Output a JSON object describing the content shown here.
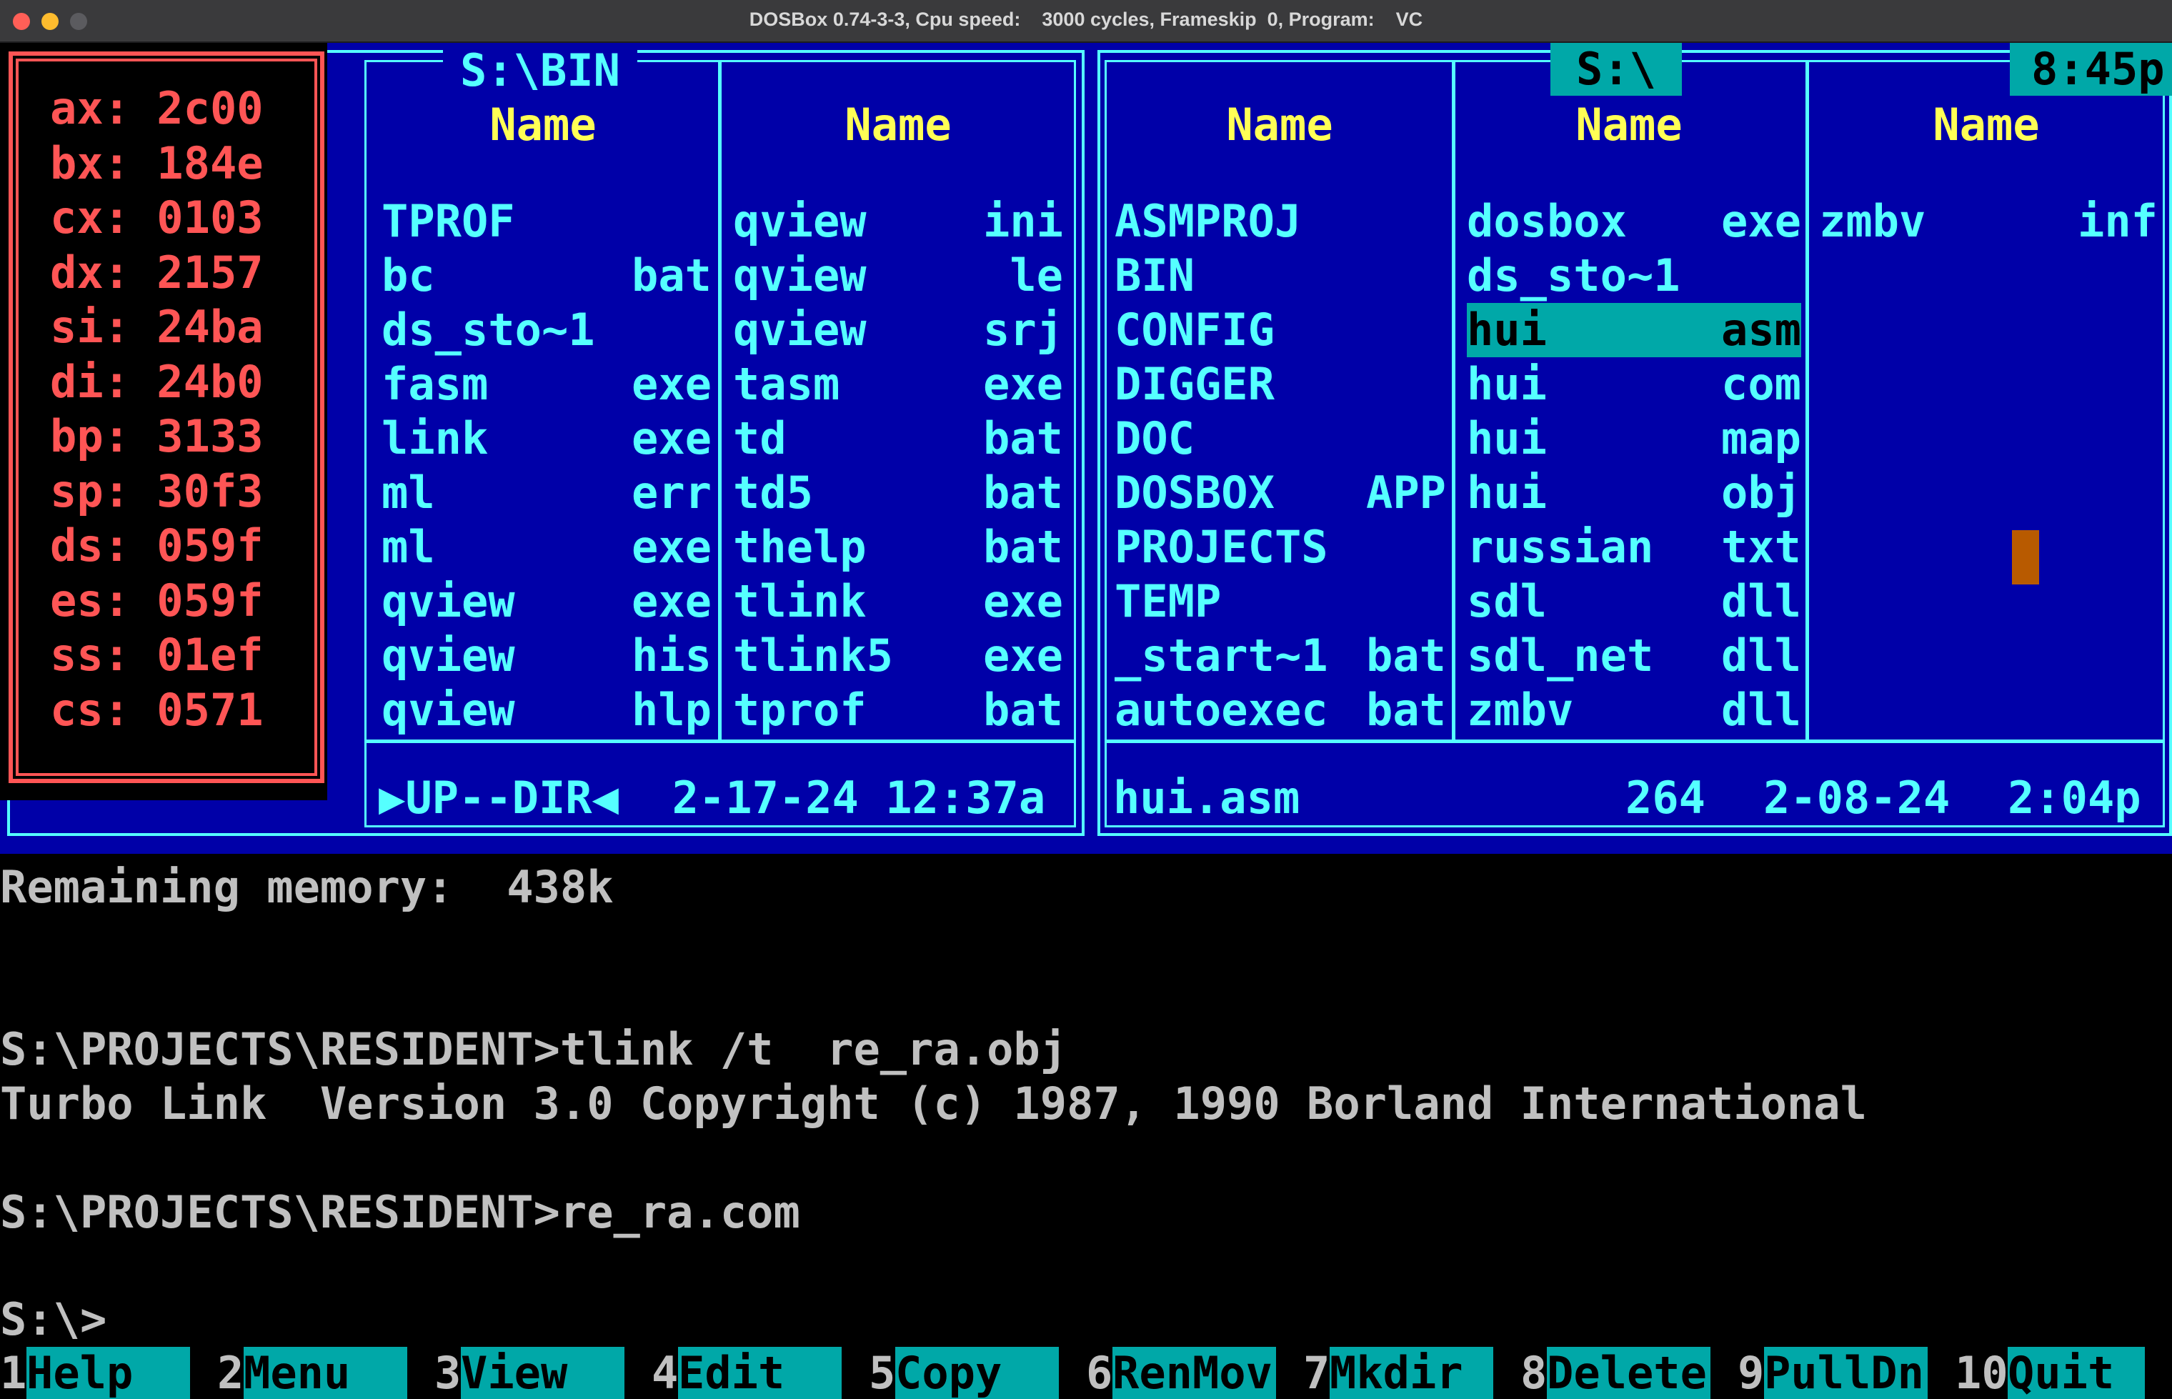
{
  "window": {
    "title": "DOSBox 0.74-3-3, Cpu speed:    3000 cycles, Frameskip  0, Program:    VC"
  },
  "left_panel": {
    "path": "S:\\BIN",
    "col_header": "Name",
    "col1": [
      {
        "name": "TPROF",
        "ext": ""
      },
      {
        "name": "bc",
        "ext": "bat"
      },
      {
        "name": "ds_sto~1",
        "ext": ""
      },
      {
        "name": "fasm",
        "ext": "exe"
      },
      {
        "name": "link",
        "ext": "exe"
      },
      {
        "name": "ml",
        "ext": "err"
      },
      {
        "name": "ml",
        "ext": "exe"
      },
      {
        "name": "qview",
        "ext": "exe"
      },
      {
        "name": "qview",
        "ext": "his"
      },
      {
        "name": "qview",
        "ext": "hlp"
      }
    ],
    "col2": [
      {
        "name": "qview",
        "ext": "ini"
      },
      {
        "name": "qview",
        "ext": "le"
      },
      {
        "name": "qview",
        "ext": "srj"
      },
      {
        "name": "tasm",
        "ext": "exe"
      },
      {
        "name": "td",
        "ext": "bat"
      },
      {
        "name": "td5",
        "ext": "bat"
      },
      {
        "name": "thelp",
        "ext": "bat"
      },
      {
        "name": "tlink",
        "ext": "exe"
      },
      {
        "name": "tlink5",
        "ext": "exe"
      },
      {
        "name": "tprof",
        "ext": "bat"
      }
    ],
    "status": "▶UP--DIR◀  2-17-24 12:37a"
  },
  "right_panel": {
    "path": "S:\\",
    "clock": "8:45p",
    "col_header": "Name",
    "col1": [
      {
        "name": "ASMPROJ",
        "ext": ""
      },
      {
        "name": "BIN",
        "ext": ""
      },
      {
        "name": "CONFIG",
        "ext": ""
      },
      {
        "name": "DIGGER",
        "ext": ""
      },
      {
        "name": "DOC",
        "ext": ""
      },
      {
        "name": "DOSBOX",
        "ext": "APP"
      },
      {
        "name": "PROJECTS",
        "ext": ""
      },
      {
        "name": "TEMP",
        "ext": ""
      },
      {
        "name": "_start~1",
        "ext": "bat"
      },
      {
        "name": "autoexec",
        "ext": "bat"
      }
    ],
    "col2": [
      {
        "name": "dosbox",
        "ext": "exe"
      },
      {
        "name": "ds_sto~1",
        "ext": ""
      },
      {
        "name": "hui",
        "ext": "asm"
      },
      {
        "name": "hui",
        "ext": "com"
      },
      {
        "name": "hui",
        "ext": "map"
      },
      {
        "name": "hui",
        "ext": "obj"
      },
      {
        "name": "russian",
        "ext": "txt"
      },
      {
        "name": "sdl",
        "ext": "dll"
      },
      {
        "name": "sdl_net",
        "ext": "dll"
      },
      {
        "name": "zmbv",
        "ext": "dll"
      }
    ],
    "col3": [
      {
        "name": "zmbv",
        "ext": "inf"
      }
    ],
    "selected": "hui.asm",
    "status_file": "hui.asm",
    "status_size": "264",
    "status_date": "2-08-24",
    "status_time": "2:04p"
  },
  "registers": [
    {
      "name": "ax:",
      "value": "2c00"
    },
    {
      "name": "bx:",
      "value": "184e"
    },
    {
      "name": "cx:",
      "value": "0103"
    },
    {
      "name": "dx:",
      "value": "2157"
    },
    {
      "name": "si:",
      "value": "24ba"
    },
    {
      "name": "di:",
      "value": "24b0"
    },
    {
      "name": "bp:",
      "value": "3133"
    },
    {
      "name": "sp:",
      "value": "30f3"
    },
    {
      "name": "ds:",
      "value": "059f"
    },
    {
      "name": "es:",
      "value": "059f"
    },
    {
      "name": "ss:",
      "value": "01ef"
    },
    {
      "name": "cs:",
      "value": "0571"
    }
  ],
  "console": {
    "memory": "Remaining memory:  438k",
    "cmd1": "S:\\PROJECTS\\RESIDENT>tlink /t  re_ra.obj",
    "out1": "Turbo Link  Version 3.0 Copyright (c) 1987, 1990 Borland International",
    "cmd2": "S:\\PROJECTS\\RESIDENT>re_ra.com",
    "prompt": "S:\\>"
  },
  "fkeys": [
    {
      "num": "1",
      "label": "Help"
    },
    {
      "num": "2",
      "label": "Menu"
    },
    {
      "num": "3",
      "label": "View"
    },
    {
      "num": "4",
      "label": "Edit"
    },
    {
      "num": "5",
      "label": "Copy"
    },
    {
      "num": "6",
      "label": "RenMov"
    },
    {
      "num": "7",
      "label": "Mkdir"
    },
    {
      "num": "8",
      "label": "Delete"
    },
    {
      "num": "9",
      "label": "PullDn"
    },
    {
      "num": "10",
      "label": "Quit"
    }
  ],
  "colors": {
    "panel_bg": "#0000a8",
    "panel_fg": "#55ffff",
    "header_fg": "#ffff55",
    "register_fg": "#ff5555",
    "cursor": "#b85a00"
  }
}
